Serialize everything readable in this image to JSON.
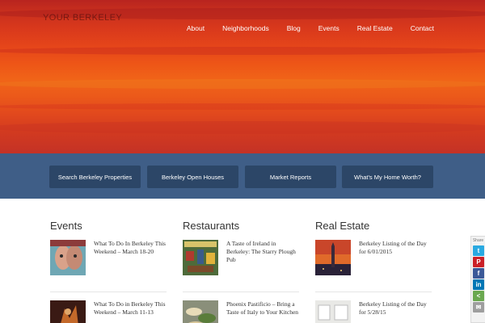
{
  "site": {
    "logo": "YOUR BERKELEY"
  },
  "nav": [
    "About",
    "Neighborhoods",
    "Blog",
    "Events",
    "Real Estate",
    "Contact"
  ],
  "cta_buttons": [
    "Search Berkeley Properties",
    "Berkeley Open Houses",
    "Market Reports",
    "What's My Home Worth?"
  ],
  "columns": [
    {
      "heading": "Events",
      "posts": [
        {
          "title": "What To Do In Berkeley This Weekend – March 18-20"
        },
        {
          "title": "What To Do in Berkeley This Weekend – March 11-13"
        }
      ]
    },
    {
      "heading": "Restaurants",
      "posts": [
        {
          "title": "A Taste of Ireland in Berkeley: The Starry Plough Pub"
        },
        {
          "title": "Phoenix Pastificio – Bring a Taste of Italy to Your Kitchen"
        }
      ]
    },
    {
      "heading": "Real Estate",
      "posts": [
        {
          "title": "Berkeley Listing of the Day for 6/01/2015"
        },
        {
          "title": "Berkeley Listing of the Day for 5/28/15"
        }
      ]
    }
  ],
  "share": {
    "label": "Share",
    "buttons": [
      {
        "icon": "twitter-icon",
        "glyph": "t",
        "color": "#29a9e1"
      },
      {
        "icon": "pinterest-icon",
        "glyph": "P",
        "color": "#cb2027"
      },
      {
        "icon": "facebook-icon",
        "glyph": "f",
        "color": "#3b5998"
      },
      {
        "icon": "linkedin-icon",
        "glyph": "in",
        "color": "#0077b5"
      },
      {
        "icon": "share-icon",
        "glyph": "<",
        "color": "#6aa84f"
      },
      {
        "icon": "email-icon",
        "glyph": "✉",
        "color": "#9e9e9e"
      }
    ]
  },
  "colors": {
    "band": "#3f5e87",
    "cta": "#2c4667",
    "hero": "#e5451a"
  }
}
